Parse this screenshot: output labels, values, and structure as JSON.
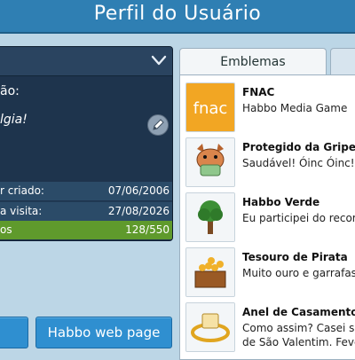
{
  "header": {
    "title": "Perfil do Usuário"
  },
  "profile": {
    "motto_label": "ão:",
    "motto": "lgia!",
    "stats": [
      {
        "label": "r criado:",
        "value": "07/06/2006"
      },
      {
        "label": "a visita:",
        "value": "27/08/2026"
      },
      {
        "label": "os",
        "value": "128/550"
      }
    ]
  },
  "buttons": {
    "web_page": "Habbo web page"
  },
  "tabs": {
    "badges": "Emblemas"
  },
  "badges": [
    {
      "name": "FNAC",
      "desc": "Habbo Media Game",
      "desc2": "",
      "icon": "fnac-logo-icon"
    },
    {
      "name": "Protegido da Gripe",
      "desc": "Saudável! Óinc Óinc!",
      "desc2": "",
      "icon": "pig-mask-icon"
    },
    {
      "name": "Habbo Verde",
      "desc": "Eu participei do recor",
      "desc2": "",
      "icon": "tree-icon"
    },
    {
      "name": "Tesouro de Pirata",
      "desc": "Muito ouro e garrafas",
      "desc2": "",
      "icon": "treasure-chest-icon"
    },
    {
      "name": "Anel de Casamento",
      "desc": "Como assim? Casei ser",
      "desc2": "de São Valentim. Fever",
      "icon": "wedding-ring-icon"
    }
  ]
}
